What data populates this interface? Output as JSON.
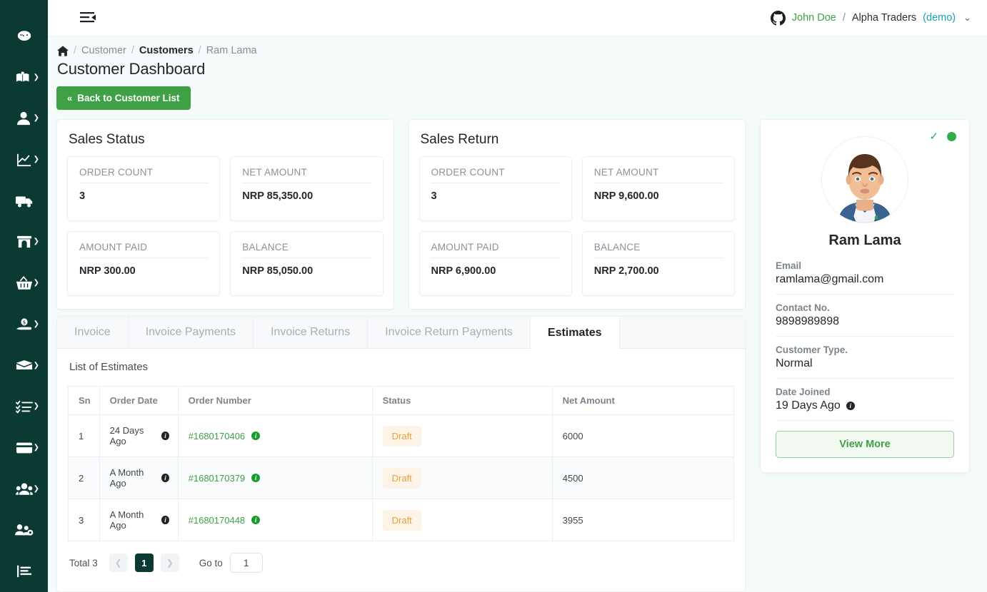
{
  "sidebar": {
    "items": [
      {
        "name": "dashboard",
        "icon": "speedometer-icon",
        "has_caret": false
      },
      {
        "name": "catalog",
        "icon": "open-book-icon",
        "has_caret": true
      },
      {
        "name": "customer",
        "icon": "user-icon",
        "has_caret": true
      },
      {
        "name": "reports",
        "icon": "line-chart-icon",
        "has_caret": true
      },
      {
        "name": "delivery",
        "icon": "truck-icon",
        "has_caret": false
      },
      {
        "name": "store",
        "icon": "storefront-icon",
        "has_caret": true
      },
      {
        "name": "purchase",
        "icon": "basket-icon",
        "has_caret": true
      },
      {
        "name": "payments",
        "icon": "hand-money-icon",
        "has_caret": true
      },
      {
        "name": "expenses",
        "icon": "wallet-open-icon",
        "has_caret": true
      },
      {
        "name": "tasks",
        "icon": "checklist-icon",
        "has_caret": true
      },
      {
        "name": "cards",
        "icon": "credit-card-icon",
        "has_caret": true
      },
      {
        "name": "users",
        "icon": "people-icon",
        "has_caret": true
      },
      {
        "name": "user-settings",
        "icon": "users-gear-icon",
        "has_caret": false
      },
      {
        "name": "analytics",
        "icon": "bar-chart-icon",
        "has_caret": false
      }
    ]
  },
  "topbar": {
    "fold_icon": "menu-fold-icon",
    "brand_icon": "github-icon",
    "user_name": "John Doe",
    "separator": "/",
    "org_name": "Alpha Traders",
    "env_label": "(demo)",
    "chevron": "chevron-down-icon"
  },
  "breadcrumb": {
    "home_icon": "home-icon",
    "items": [
      "Customer",
      "Customers",
      "Ram Lama"
    ],
    "separator": "/"
  },
  "page": {
    "title": "Customer Dashboard",
    "back_button": "Back to Customer List",
    "back_icon": "double-chevron-left-icon"
  },
  "sales_status": {
    "title": "Sales Status",
    "stats": [
      {
        "label": "ORDER COUNT",
        "value": "3"
      },
      {
        "label": "NET AMOUNT",
        "value": "NRP 85,350.00"
      },
      {
        "label": "AMOUNT PAID",
        "value": "NRP 300.00"
      },
      {
        "label": "BALANCE",
        "value": "NRP 85,050.00"
      }
    ]
  },
  "sales_return": {
    "title": "Sales Return",
    "stats": [
      {
        "label": "ORDER COUNT",
        "value": "3"
      },
      {
        "label": "NET AMOUNT",
        "value": "NRP 9,600.00"
      },
      {
        "label": "AMOUNT PAID",
        "value": "NRP 6,900.00"
      },
      {
        "label": "BALANCE",
        "value": "NRP 2,700.00"
      }
    ]
  },
  "tabs": [
    {
      "label": "Invoice",
      "active": false
    },
    {
      "label": "Invoice Payments",
      "active": false
    },
    {
      "label": "Invoice Returns",
      "active": false
    },
    {
      "label": "Invoice Return Payments",
      "active": false
    },
    {
      "label": "Estimates",
      "active": true
    }
  ],
  "table": {
    "section_title": "List of Estimates",
    "columns": [
      "Sn",
      "Order Date",
      "Order Number",
      "Status",
      "Net Amount"
    ],
    "rows": [
      {
        "sn": "1",
        "order_date": "24 Days Ago",
        "order_number": "#1680170406",
        "status": "Draft",
        "net_amount": "6000"
      },
      {
        "sn": "2",
        "order_date": "A Month Ago",
        "order_number": "#1680170379",
        "status": "Draft",
        "net_amount": "4500"
      },
      {
        "sn": "3",
        "order_date": "A Month Ago",
        "order_number": "#1680170448",
        "status": "Draft",
        "net_amount": "3955"
      }
    ]
  },
  "pagination": {
    "total_label": "Total 3",
    "prev_icon": "chevron-left-icon",
    "current_page": "1",
    "next_icon": "chevron-right-icon",
    "goto_label": "Go to",
    "goto_value": "1"
  },
  "profile": {
    "avatar": "user-avatar-illustration",
    "verified_icon": "check-icon",
    "online_icon": "online-status-dot",
    "name": "Ram Lama",
    "fields": [
      {
        "label": "Email",
        "value": "ramlama@gmail.com",
        "info": false
      },
      {
        "label": "Contact No.",
        "value": "9898989898",
        "info": false
      },
      {
        "label": "Customer Type.",
        "value": "Normal",
        "info": false
      },
      {
        "label": "Date Joined",
        "value": "19 Days Ago",
        "info": true
      }
    ],
    "view_more": "View More"
  },
  "colors": {
    "sidebar_bg": "#0b3a32",
    "accent_green": "#3fa046",
    "link_green": "#3fa046",
    "badge_bg": "#fdf3e7",
    "badge_text": "#e5a33e",
    "page_bg": "#f5fafb",
    "teal": "#17a2b8"
  }
}
